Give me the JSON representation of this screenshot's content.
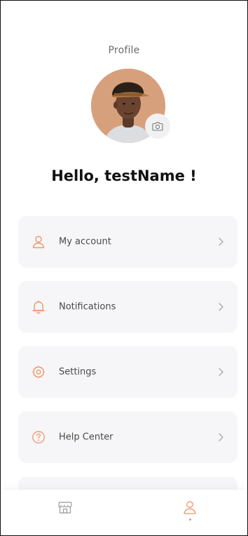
{
  "header": {
    "title": "Profile"
  },
  "profile": {
    "greeting": "Hello, testName !",
    "avatar_icon": "user-photo",
    "camera_icon": "camera-icon"
  },
  "menu": {
    "items": [
      {
        "label": "My account",
        "icon": "user-icon"
      },
      {
        "label": "Notifications",
        "icon": "bell-icon"
      },
      {
        "label": "Settings",
        "icon": "gear-icon"
      },
      {
        "label": "Help Center",
        "icon": "question-icon"
      }
    ],
    "chevron_icon": "chevron-right-icon"
  },
  "bottom_nav": {
    "tabs": [
      {
        "name": "shop",
        "icon": "shop-icon",
        "active": false
      },
      {
        "name": "profile",
        "icon": "user-icon",
        "active": true
      }
    ]
  },
  "colors": {
    "accent": "#F0956A",
    "item_bg": "#F6F6F8",
    "text_dark": "#121212",
    "text_muted": "#6B6B6B",
    "icon_muted": "#A8A8A8"
  }
}
